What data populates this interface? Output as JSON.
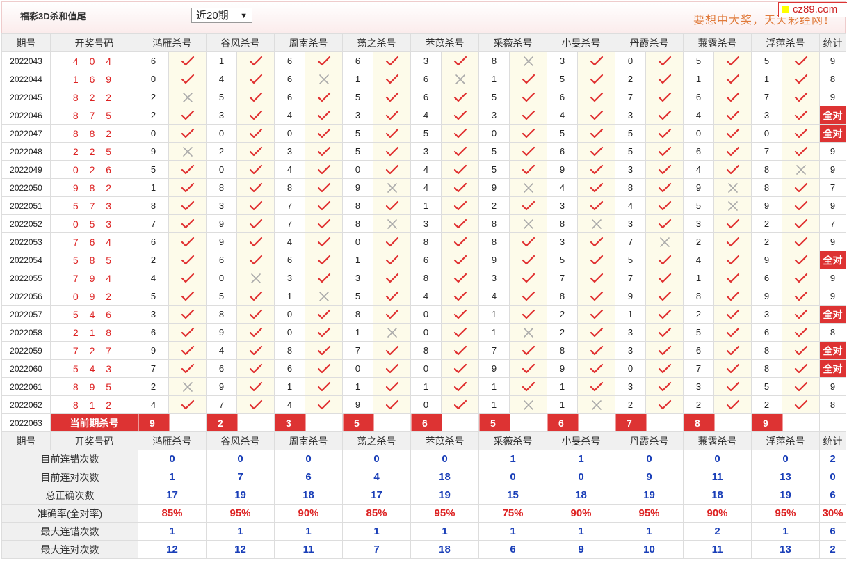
{
  "header": {
    "title": "福彩3D杀和值尾",
    "period_select": "近20期",
    "ad_text": "要想中大奖，天天彩经网！",
    "site_badge": "cz89.com"
  },
  "columns": {
    "issue": "期号",
    "draw": "开奖号码",
    "experts": [
      "鸿雁杀号",
      "谷风杀号",
      "周南杀号",
      "荡之杀号",
      "芣苡杀号",
      "采薇杀号",
      "小旻杀号",
      "丹霞杀号",
      "蒹露杀号",
      "浮萍杀号"
    ],
    "stat": "统计"
  },
  "rows": [
    {
      "issue": "2022043",
      "draw": "4 0 4",
      "nums": [
        6,
        1,
        6,
        6,
        3,
        8,
        3,
        0,
        5,
        5
      ],
      "hits": [
        1,
        1,
        1,
        1,
        1,
        0,
        1,
        1,
        1,
        1
      ],
      "stat": "9"
    },
    {
      "issue": "2022044",
      "draw": "1 6 9",
      "nums": [
        0,
        4,
        6,
        1,
        6,
        1,
        5,
        2,
        1,
        1
      ],
      "hits": [
        1,
        1,
        0,
        1,
        0,
        1,
        1,
        1,
        1,
        1
      ],
      "stat": "8"
    },
    {
      "issue": "2022045",
      "draw": "8 2 2",
      "nums": [
        2,
        5,
        6,
        5,
        6,
        5,
        6,
        7,
        6,
        7
      ],
      "hits": [
        0,
        1,
        1,
        1,
        1,
        1,
        1,
        1,
        1,
        1
      ],
      "stat": "9"
    },
    {
      "issue": "2022046",
      "draw": "8 7 5",
      "nums": [
        2,
        3,
        4,
        3,
        4,
        3,
        4,
        3,
        4,
        3
      ],
      "hits": [
        1,
        1,
        1,
        1,
        1,
        1,
        1,
        1,
        1,
        1
      ],
      "stat": "全对"
    },
    {
      "issue": "2022047",
      "draw": "8 8 2",
      "nums": [
        0,
        0,
        0,
        5,
        5,
        0,
        5,
        5,
        0,
        0
      ],
      "hits": [
        1,
        1,
        1,
        1,
        1,
        1,
        1,
        1,
        1,
        1
      ],
      "stat": "全对"
    },
    {
      "issue": "2022048",
      "draw": "2 2 5",
      "nums": [
        9,
        2,
        3,
        5,
        3,
        5,
        6,
        5,
        6,
        7
      ],
      "hits": [
        0,
        1,
        1,
        1,
        1,
        1,
        1,
        1,
        1,
        1
      ],
      "stat": "9"
    },
    {
      "issue": "2022049",
      "draw": "0 2 6",
      "nums": [
        5,
        0,
        4,
        0,
        4,
        5,
        9,
        3,
        4,
        8
      ],
      "hits": [
        1,
        1,
        1,
        1,
        1,
        1,
        1,
        1,
        1,
        0
      ],
      "stat": "9"
    },
    {
      "issue": "2022050",
      "draw": "9 8 2",
      "nums": [
        1,
        8,
        8,
        9,
        4,
        9,
        4,
        8,
        9,
        8
      ],
      "hits": [
        1,
        1,
        1,
        0,
        1,
        0,
        1,
        1,
        0,
        1
      ],
      "stat": "7"
    },
    {
      "issue": "2022051",
      "draw": "5 7 3",
      "nums": [
        8,
        3,
        7,
        8,
        1,
        2,
        3,
        4,
        5,
        9
      ],
      "hits": [
        1,
        1,
        1,
        1,
        1,
        1,
        1,
        1,
        0,
        1
      ],
      "stat": "9"
    },
    {
      "issue": "2022052",
      "draw": "0 5 3",
      "nums": [
        7,
        9,
        7,
        8,
        3,
        8,
        8,
        3,
        3,
        2
      ],
      "hits": [
        1,
        1,
        1,
        0,
        1,
        0,
        0,
        1,
        1,
        1
      ],
      "stat": "7"
    },
    {
      "issue": "2022053",
      "draw": "7 6 4",
      "nums": [
        6,
        9,
        4,
        0,
        8,
        8,
        3,
        7,
        2,
        2
      ],
      "hits": [
        1,
        1,
        1,
        1,
        1,
        1,
        1,
        0,
        1,
        1
      ],
      "stat": "9"
    },
    {
      "issue": "2022054",
      "draw": "5 8 5",
      "nums": [
        2,
        6,
        6,
        1,
        6,
        9,
        5,
        5,
        4,
        9
      ],
      "hits": [
        1,
        1,
        1,
        1,
        1,
        1,
        1,
        1,
        1,
        1
      ],
      "stat": "全对"
    },
    {
      "issue": "2022055",
      "draw": "7 9 4",
      "nums": [
        4,
        0,
        3,
        3,
        8,
        3,
        7,
        7,
        1,
        6
      ],
      "hits": [
        1,
        0,
        1,
        1,
        1,
        1,
        1,
        1,
        1,
        1
      ],
      "stat": "9"
    },
    {
      "issue": "2022056",
      "draw": "0 9 2",
      "nums": [
        5,
        5,
        1,
        5,
        4,
        4,
        8,
        9,
        8,
        9
      ],
      "hits": [
        1,
        1,
        0,
        1,
        1,
        1,
        1,
        1,
        1,
        1
      ],
      "stat": "9"
    },
    {
      "issue": "2022057",
      "draw": "5 4 6",
      "nums": [
        3,
        8,
        0,
        8,
        0,
        1,
        2,
        1,
        2,
        3
      ],
      "hits": [
        1,
        1,
        1,
        1,
        1,
        1,
        1,
        1,
        1,
        1
      ],
      "stat": "全对"
    },
    {
      "issue": "2022058",
      "draw": "2 1 8",
      "nums": [
        6,
        9,
        0,
        1,
        0,
        1,
        2,
        3,
        5,
        6
      ],
      "hits": [
        1,
        1,
        1,
        0,
        1,
        0,
        1,
        1,
        1,
        1
      ],
      "stat": "8"
    },
    {
      "issue": "2022059",
      "draw": "7 2 7",
      "nums": [
        9,
        4,
        8,
        7,
        8,
        7,
        8,
        3,
        6,
        8
      ],
      "hits": [
        1,
        1,
        1,
        1,
        1,
        1,
        1,
        1,
        1,
        1
      ],
      "stat": "全对"
    },
    {
      "issue": "2022060",
      "draw": "5 4 3",
      "nums": [
        7,
        6,
        6,
        0,
        0,
        9,
        9,
        0,
        7,
        8
      ],
      "hits": [
        1,
        1,
        1,
        1,
        1,
        1,
        1,
        1,
        1,
        1
      ],
      "stat": "全对"
    },
    {
      "issue": "2022061",
      "draw": "8 9 5",
      "nums": [
        2,
        9,
        1,
        1,
        1,
        1,
        1,
        3,
        3,
        5
      ],
      "hits": [
        0,
        1,
        1,
        1,
        1,
        1,
        1,
        1,
        1,
        1
      ],
      "stat": "9"
    },
    {
      "issue": "2022062",
      "draw": "8 1 2",
      "nums": [
        4,
        7,
        4,
        9,
        0,
        1,
        1,
        2,
        2,
        2
      ],
      "hits": [
        1,
        1,
        1,
        1,
        1,
        0,
        0,
        1,
        1,
        1
      ],
      "stat": "8"
    }
  ],
  "current": {
    "issue": "2022063",
    "label": "当前期杀号",
    "kills": [
      "9",
      "2",
      "3",
      "5",
      "6",
      "5",
      "6",
      "7",
      "8",
      "9"
    ]
  },
  "stats": [
    {
      "label": "目前连错次数",
      "values": [
        "0",
        "0",
        "0",
        "0",
        "0",
        "1",
        "1",
        "0",
        "0",
        "0"
      ],
      "stat": "2",
      "red": false
    },
    {
      "label": "目前连对次数",
      "values": [
        "1",
        "7",
        "6",
        "4",
        "18",
        "0",
        "0",
        "9",
        "11",
        "13"
      ],
      "stat": "0",
      "red": false
    },
    {
      "label": "总正确次数",
      "values": [
        "17",
        "19",
        "18",
        "17",
        "19",
        "15",
        "18",
        "19",
        "18",
        "19"
      ],
      "stat": "6",
      "red": false
    },
    {
      "label": "准确率(全对率)",
      "values": [
        "85%",
        "95%",
        "90%",
        "85%",
        "95%",
        "75%",
        "90%",
        "95%",
        "90%",
        "95%"
      ],
      "stat": "30%",
      "red": true
    },
    {
      "label": "最大连错次数",
      "values": [
        "1",
        "1",
        "1",
        "1",
        "1",
        "1",
        "1",
        "1",
        "2",
        "1"
      ],
      "stat": "6",
      "red": false
    },
    {
      "label": "最大连对次数",
      "values": [
        "12",
        "12",
        "11",
        "7",
        "18",
        "6",
        "9",
        "10",
        "11",
        "13"
      ],
      "stat": "2",
      "red": false
    }
  ],
  "colors": {
    "accent_red": "#dd3333",
    "tick": "#e03030",
    "cross": "#aaaaaa",
    "stat_blue": "#1a3fb8"
  }
}
